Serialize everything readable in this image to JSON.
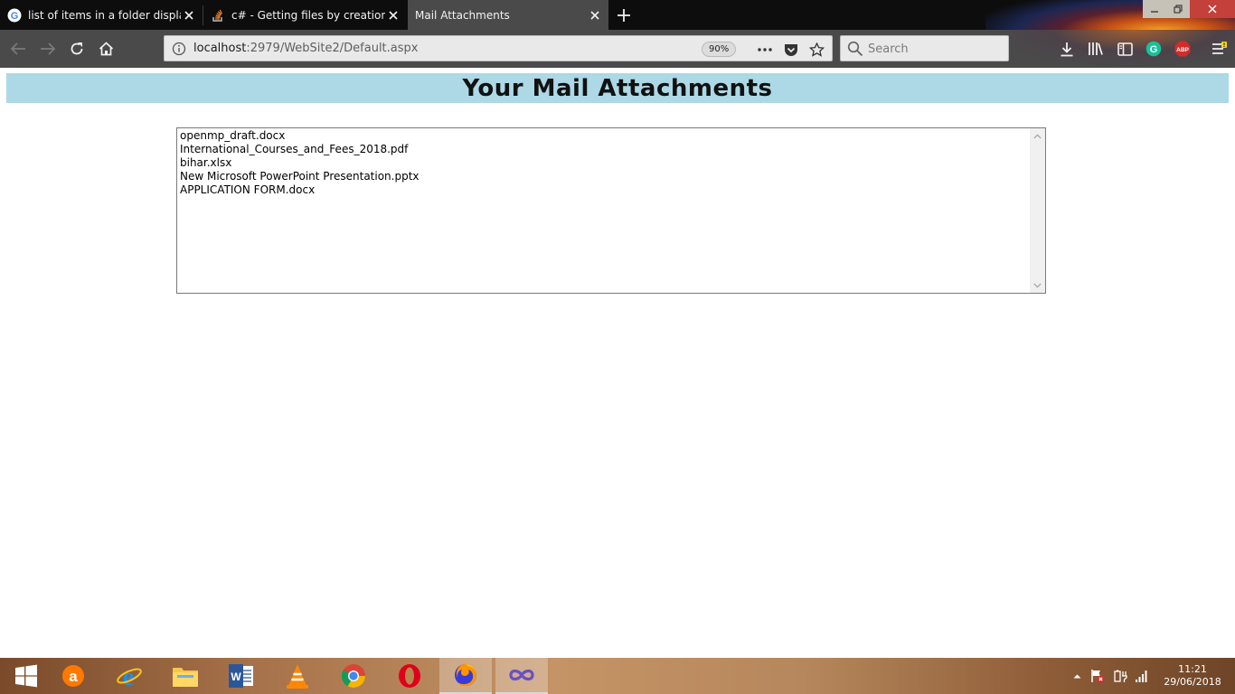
{
  "browser": {
    "tabs": [
      {
        "label": "list of items in a folder displayin",
        "icon": "google-icon"
      },
      {
        "label": "c# - Getting files by creation da",
        "icon": "stackoverflow-icon"
      },
      {
        "label": "Mail Attachments",
        "icon": "none",
        "active": true
      }
    ],
    "url": {
      "host": "localhost",
      "rest": ":2979/WebSite2/Default.aspx"
    },
    "zoom": "90%",
    "search_placeholder": "Search"
  },
  "page": {
    "title": "Your Mail Attachments",
    "attachments": [
      "openmp_draft.docx",
      "International_Courses_and_Fees_2018.pdf",
      "bihar.xlsx",
      "New Microsoft PowerPoint Presentation.pptx",
      "APPLICATION FORM.docx"
    ],
    "header_color": "#add8e6"
  },
  "taskbar": {
    "time": "11:21",
    "date": "29/06/2018",
    "pinned": [
      "windows-start",
      "avast",
      "internet-explorer",
      "file-explorer",
      "word",
      "vlc",
      "chrome",
      "opera",
      "firefox",
      "visual-studio"
    ]
  }
}
